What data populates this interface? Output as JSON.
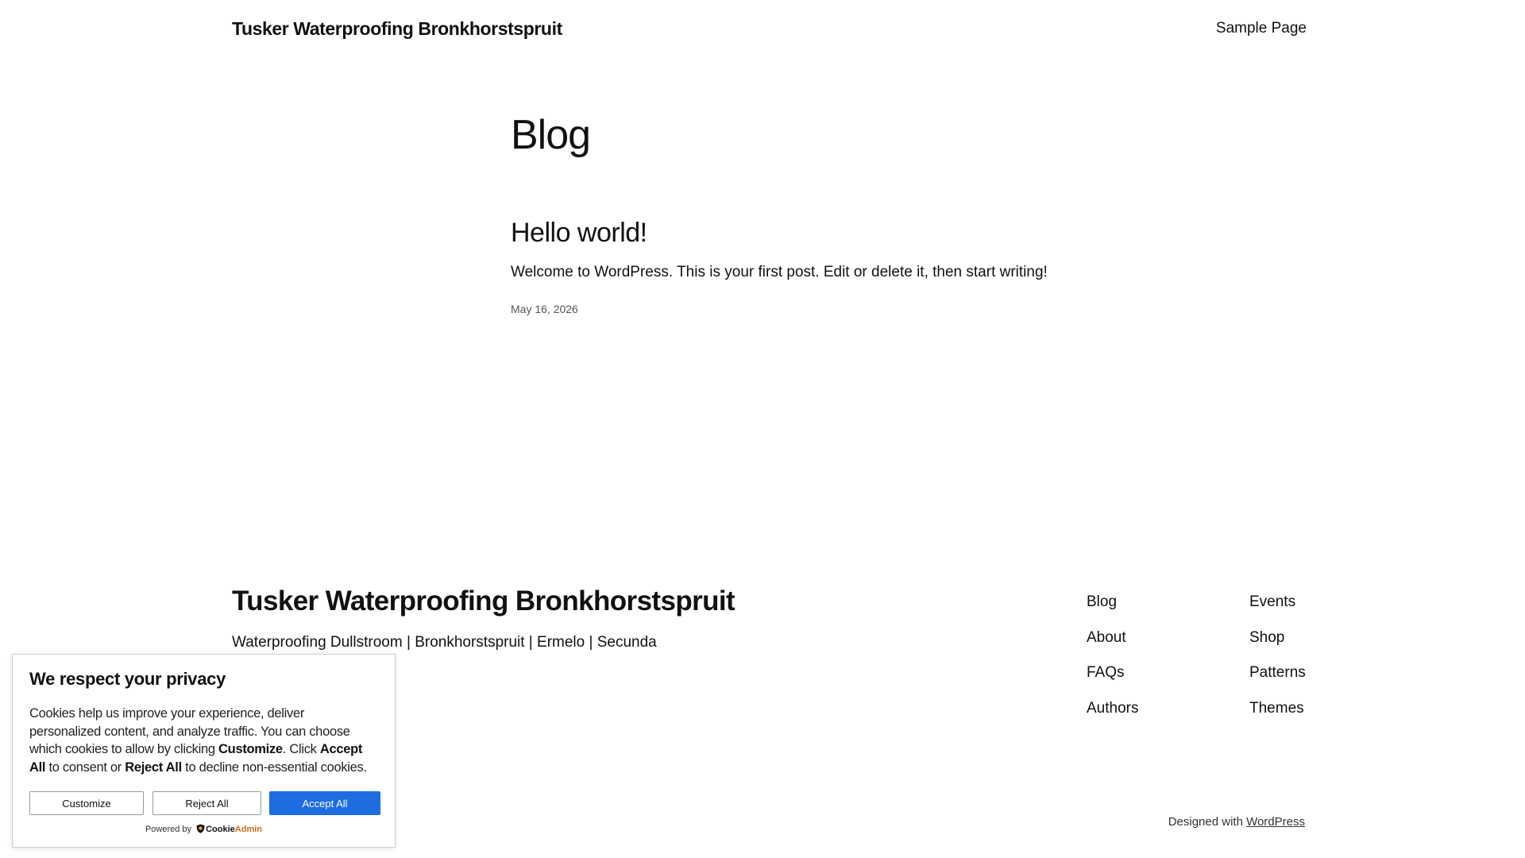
{
  "header": {
    "site_title": "Tusker Waterproofing Bronkhorstspruit",
    "nav": [
      "Sample Page"
    ]
  },
  "main": {
    "heading": "Blog",
    "posts": [
      {
        "title": "Hello world!",
        "excerpt": "Welcome to WordPress. This is your first post. Edit or delete it, then start writing!",
        "date": "May 16, 2026"
      }
    ]
  },
  "footer": {
    "title": "Tusker Waterproofing Bronkhorstspruit",
    "tagline": "Waterproofing Dullstroom | Bronkhorstspruit | Ermelo | Secunda",
    "nav_col1": [
      "Blog",
      "About",
      "FAQs",
      "Authors"
    ],
    "nav_col2": [
      "Events",
      "Shop",
      "Patterns",
      "Themes"
    ],
    "credit_prefix": "Designed with",
    "credit_link": "WordPress"
  },
  "cookie_banner": {
    "title": "We respect your privacy",
    "text_part1": "Cookies help us improve your experience, deliver personalized content, and analyze traffic. You can choose which cookies to allow by clicking",
    "text_customize": "Customize",
    "text_part2": ". Click",
    "text_accept": "Accept All",
    "text_part3": "to consent or",
    "text_reject": "Reject All",
    "text_part4": "to decline non-essential cookies.",
    "customize_label": "Customize",
    "reject_label": "Reject All",
    "accept_label": "Accept All",
    "powered_by": "Powered by",
    "brand_part1": "Cookie",
    "brand_part2": "Admin",
    "accept_color": "#1d6de0",
    "brand_accent_color": "#c8741a"
  }
}
